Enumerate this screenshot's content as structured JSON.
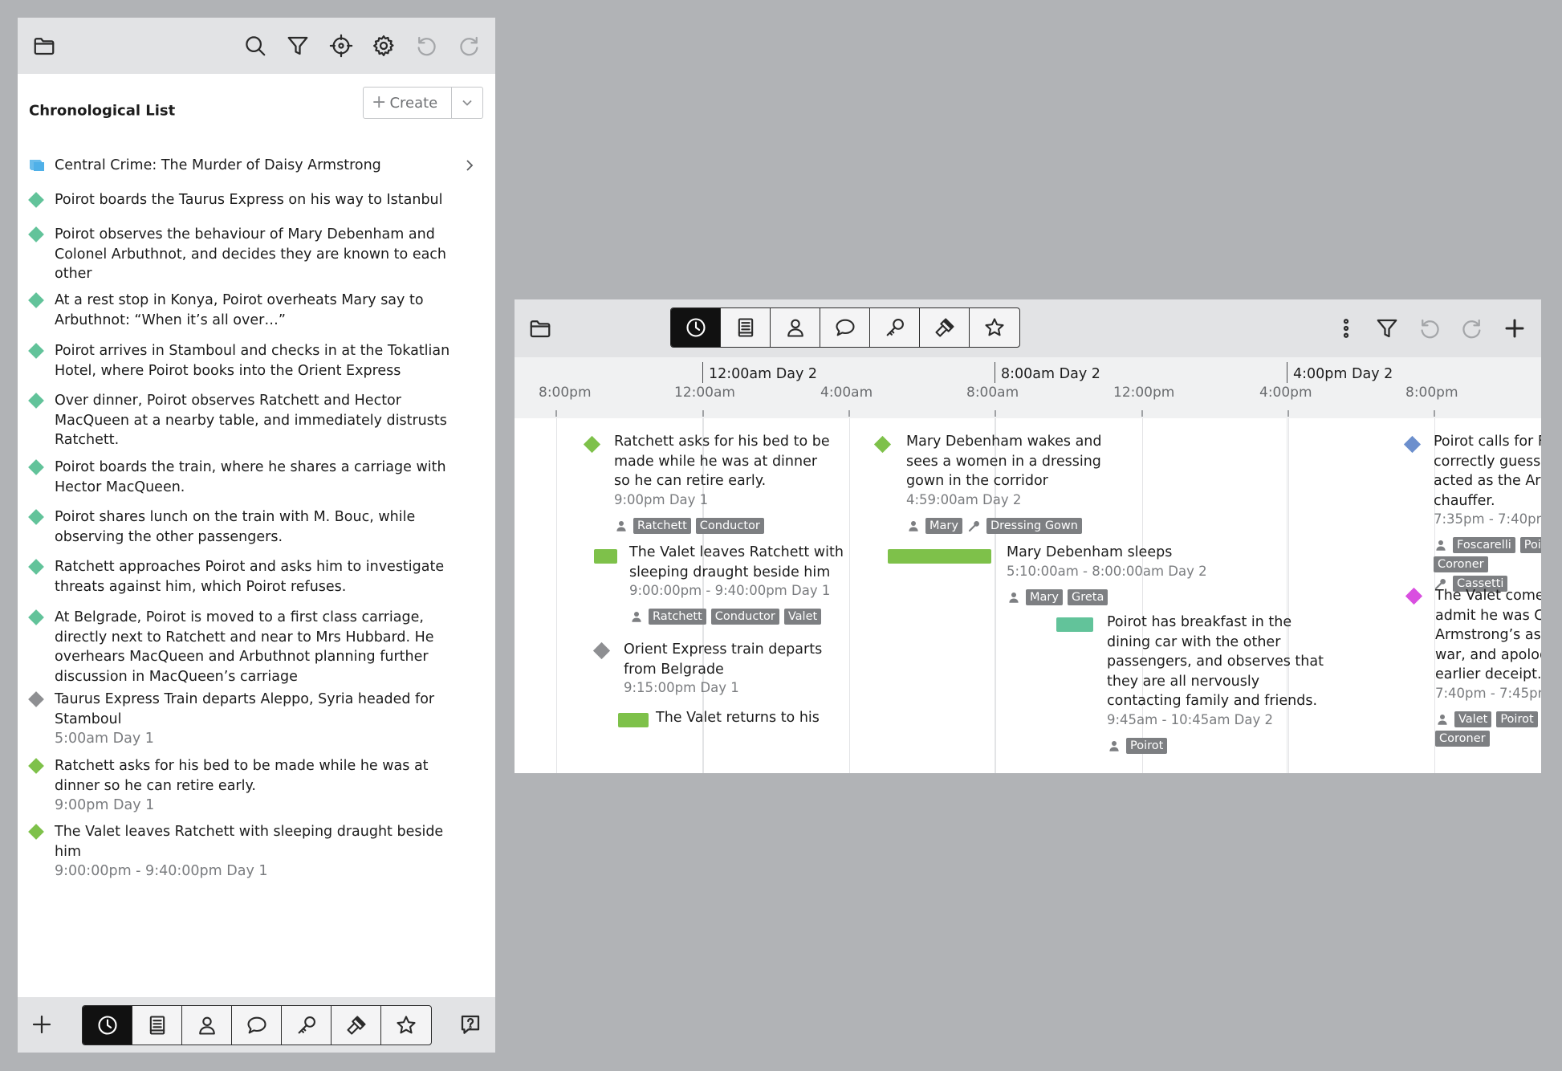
{
  "colors": {
    "event_green": "#7ec14a",
    "event_teal": "#62c39a",
    "event_gray": "#8e8f92",
    "event_blue": "#6c8fcd",
    "event_magenta": "#d94fe0",
    "arc_blue": "#4fb0e8",
    "tag_gray": "#7d7f82",
    "background": "#b1b3b6"
  },
  "left_panel": {
    "toolbar": {
      "icons": [
        "folder-icon",
        "search-icon",
        "filter-icon",
        "crosshair-icon",
        "gear-icon",
        "undo-icon",
        "redo-icon"
      ]
    },
    "title": "Chronological List",
    "create_button": {
      "plus": "+",
      "label": "Create"
    },
    "items": [
      {
        "text": "Central Crime: The Murder of Daisy Armstrong",
        "kind": "arc",
        "icon": "story-arc-icon",
        "time": ""
      },
      {
        "text": "Poirot boards the Taurus Express on his way to Istanbul",
        "kind": "teal",
        "time": ""
      },
      {
        "text": "Poirot observes the behaviour of Mary Debenham and Colonel Arbuthnot, and decides they are known to each other",
        "kind": "teal",
        "time": ""
      },
      {
        "text": "At a rest stop in Konya, Poirot overheats Mary say to Arbuthnot: “When it’s all over…”",
        "kind": "teal",
        "time": ""
      },
      {
        "text": "Poirot arrives in Stamboul and checks in at the Tokatlian Hotel, where Poirot books into the Orient Express",
        "kind": "teal",
        "time": ""
      },
      {
        "text": "Over dinner, Poirot observes Ratchett and Hector MacQueen at a nearby table, and immediately distrusts Ratchett.",
        "kind": "teal",
        "time": ""
      },
      {
        "text": "Poirot boards the train, where he shares a carriage with Hector MacQueen.",
        "kind": "teal",
        "time": ""
      },
      {
        "text": "Poirot shares lunch on the train with M. Bouc, while observing the other passengers.",
        "kind": "teal",
        "time": ""
      },
      {
        "text": "Ratchett approaches Poirot and asks him to investigate threats against him, which Poirot refuses.",
        "kind": "teal",
        "time": ""
      },
      {
        "text": "At Belgrade, Poirot is moved to a first class carriage, directly next to Ratchett and near to Mrs Hubbard. He overhears MacQueen and Arbuthnot planning further discussion in MacQueen’s carriage",
        "kind": "teal",
        "time": ""
      },
      {
        "text": "Taurus Express Train departs Aleppo, Syria headed for Stamboul",
        "kind": "gray",
        "time": "5:00am Day 1"
      },
      {
        "text": "Ratchett asks for his bed to be made while he was at dinner so he can retire early.",
        "kind": "green",
        "time": "9:00pm Day 1"
      },
      {
        "text": "The Valet leaves Ratchett with sleeping draught beside him",
        "kind": "green",
        "time": "9:00:00pm - 9:40:00pm Day 1"
      }
    ],
    "bottom_bar": {
      "add_icon": "plus-icon",
      "tabs": [
        "clock-icon",
        "book-icon",
        "person-icon",
        "speech-bubble-icon",
        "key-icon",
        "gavel-icon",
        "star-icon"
      ],
      "active_tab": "clock-icon",
      "help_icon": "help-icon"
    }
  },
  "timeline": {
    "toolbar": {
      "tabs": [
        "clock-icon",
        "book-icon",
        "person-icon",
        "speech-bubble-icon",
        "key-icon",
        "gavel-icon",
        "star-icon"
      ],
      "active_tab": "clock-icon",
      "right_icons": [
        "more-vertical-icon",
        "filter-icon",
        "undo-icon",
        "redo-icon",
        "plus-icon"
      ]
    },
    "major_labels": [
      "12:00am Day 2",
      "8:00am Day 2",
      "4:00pm Day 2"
    ],
    "minor_labels": [
      "8:00pm",
      "12:00am",
      "4:00am",
      "8:00am",
      "12:00pm",
      "4:00pm",
      "8:00pm"
    ],
    "events": [
      {
        "title": [
          "Ratchett asks for his bed to be",
          "made while he was at dinner",
          "so he can retire early."
        ],
        "time": "9:00pm Day 1",
        "color": "#7ec14a",
        "marker": "diamond",
        "characters": [
          "Ratchett",
          "Conductor"
        ],
        "items": []
      },
      {
        "title": [
          "The Valet leaves Ratchett with",
          "sleeping draught beside him"
        ],
        "time": "9:00:00pm - 9:40:00pm Day 1",
        "color": "#7ec14a",
        "marker": "bar",
        "characters": [
          "Ratchett",
          "Conductor",
          "Valet"
        ],
        "items": []
      },
      {
        "title": [
          "Orient Express train departs",
          "from Belgrade"
        ],
        "time": "9:15:00pm Day 1",
        "color": "#8e8f92",
        "marker": "diamond",
        "characters": [],
        "items": []
      },
      {
        "title": [
          "The Valet returns to his"
        ],
        "time": "",
        "color": "#7ec14a",
        "marker": "bar",
        "characters": [],
        "items": []
      },
      {
        "title": [
          "Mary Debenham wakes and",
          "sees a women in a dressing",
          "gown in the corridor"
        ],
        "time": "4:59:00am Day 2",
        "color": "#7ec14a",
        "marker": "diamond",
        "characters": [
          "Mary"
        ],
        "items": [
          "Dressing Gown"
        ]
      },
      {
        "title": [
          "Mary Debenham sleeps"
        ],
        "time": "5:10:00am - 8:00:00am Day 2",
        "color": "#7ec14a",
        "marker": "bar",
        "characters": [
          "Mary",
          "Greta"
        ],
        "items": []
      },
      {
        "title": [
          "Poirot has breakfast in the",
          "dining car with the other",
          "passengers, and observes that",
          "they are all nervously",
          "contacting family and friends."
        ],
        "time": "9:45am - 10:45am Day 2",
        "color": "#62c39a",
        "marker": "bar",
        "characters": [
          "Poirot"
        ],
        "items": []
      },
      {
        "title": [
          "Poirot calls for F",
          "correctly guesse",
          "acted as the Arm",
          "chauffer."
        ],
        "time": "7:35pm - 7:40pm",
        "color": "#6c8fcd",
        "marker": "diamond",
        "characters": [
          "Foscarelli",
          "Poir",
          "Coroner"
        ],
        "items": [
          "Cassetti"
        ]
      },
      {
        "title": [
          "The Valet comes",
          "admit he was Co",
          "Armstrong’s ass",
          "war, and apologi",
          "earlier deceipt."
        ],
        "time": "7:40pm - 7:45pm",
        "color": "#d94fe0",
        "marker": "diamond",
        "characters": [
          "Valet",
          "Poirot",
          "Coroner"
        ],
        "items": []
      }
    ]
  }
}
